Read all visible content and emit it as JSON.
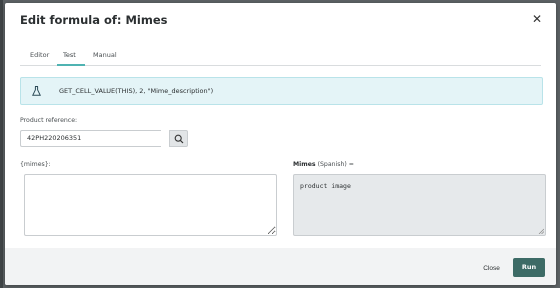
{
  "dialog": {
    "title": "Edit formula of: Mimes"
  },
  "tabs": [
    {
      "label": "Editor",
      "active": false
    },
    {
      "label": "Test",
      "active": true
    },
    {
      "label": "Manual",
      "active": false
    }
  ],
  "formula": {
    "text": "GET_CELL_VALUE(THIS), 2, \"Mime_description\")",
    "icon": "flask-icon"
  },
  "product_reference": {
    "label": "Product reference:",
    "value": "42PH220206351"
  },
  "mimes_field": {
    "label": "{mimes}:",
    "value": ""
  },
  "output": {
    "label_bold": "Mimes",
    "label_rest": " (Spanish) =",
    "value": "product image"
  },
  "footer": {
    "close_label": "Close",
    "run_label": "Run"
  },
  "colors": {
    "accent": "#4fb3b2",
    "run_button": "#3d6b66",
    "formula_bg": "#e4f4f7"
  }
}
